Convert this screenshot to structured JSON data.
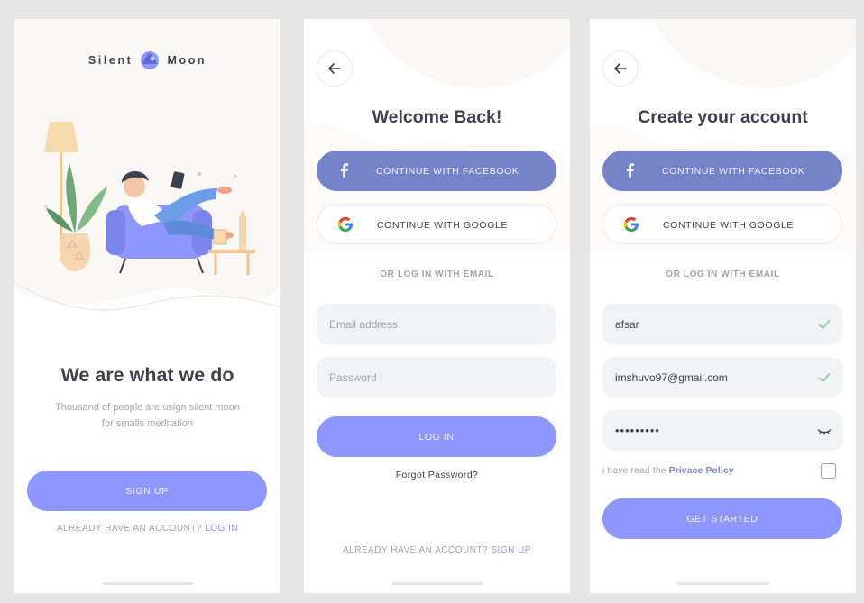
{
  "screen1": {
    "brand_left": "Silent",
    "brand_right": "Moon",
    "title": "We are what we do",
    "subtitle_line1": "Thousand of people are usign silent moon",
    "subtitle_line2": "for smalls meditation",
    "signup_button": "SIGN UP",
    "footer_prefix": "ALREADY HAVE AN ACCOUNT?",
    "footer_link": "LOG IN"
  },
  "screen2": {
    "title": "Welcome Back!",
    "facebook_button": "CONTINUE WITH FACEBOOK",
    "google_button": "CONTINUE WITH GOOGLE",
    "or_text": "OR LOG IN WITH EMAIL",
    "email_placeholder": "Email address",
    "password_placeholder": "Password",
    "login_button": "LOG IN",
    "forgot_password": "Forgot Password?",
    "footer_prefix": "ALREADY HAVE AN ACCOUNT?",
    "footer_link": "SIGN UP"
  },
  "screen3": {
    "title": "Create your account",
    "facebook_button": "CONTINUE WITH FACEBOOK",
    "google_button": "CONTINUE WITH GOOGLE",
    "or_text": "OR LOG IN WITH EMAIL",
    "name_value": "afsar",
    "email_value": "imshuvo97@gmail.com",
    "password_value": "•••••••••",
    "policy_prefix": "i have read the",
    "policy_link": "Privace Policy",
    "policy_checked": false,
    "get_started_button": "GET STARTED"
  },
  "colors": {
    "primary": "#8e97fd",
    "facebook": "#7583ca",
    "text_dark": "#3f414e",
    "text_muted": "#a1a4b2",
    "field_bg": "#f2f3f7",
    "valid_check": "#7fd6a1"
  },
  "icons": {
    "back": "arrow-left-icon",
    "facebook": "facebook-icon",
    "google": "google-icon",
    "valid": "check-icon",
    "password_toggle": "eye-closed-icon",
    "brand": "moon-logo-icon"
  }
}
